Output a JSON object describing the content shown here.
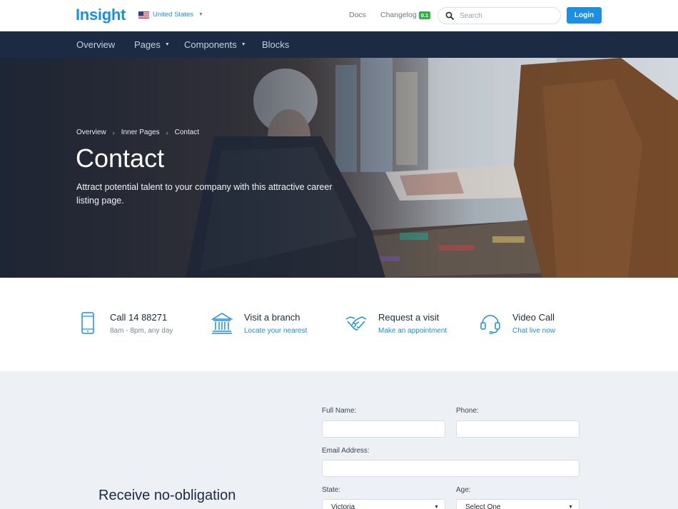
{
  "header": {
    "logo": "Insight",
    "locale": "United States",
    "links": {
      "docs": "Docs",
      "changelog": "Changelog",
      "changelog_badge": "0.1"
    },
    "search_placeholder": "Search",
    "login": "Login"
  },
  "nav": {
    "items": [
      {
        "label": "Overview"
      },
      {
        "label": "Pages"
      },
      {
        "label": "Components"
      },
      {
        "label": "Blocks"
      }
    ]
  },
  "hero": {
    "breadcrumb": [
      "Overview",
      "Inner Pages",
      "Contact"
    ],
    "title": "Contact",
    "subtitle": "Attract potential talent to your company with this attractive career listing page."
  },
  "contact_options": [
    {
      "icon": "phone-icon",
      "title": "Call 14 88271",
      "subtitle": "8am - 8pm, any day"
    },
    {
      "icon": "bank-icon",
      "title": "Visit a branch",
      "subtitle": "Locate your nearest"
    },
    {
      "icon": "handshake-icon",
      "title": "Request a visit",
      "subtitle": "Make an appointment"
    },
    {
      "icon": "headset-icon",
      "title": "Video Call",
      "subtitle": "Chat live now"
    }
  ],
  "form": {
    "heading": "Receive no-obligation",
    "labels": {
      "full_name": "Full Name:",
      "phone": "Phone:",
      "email": "Email Address:",
      "state": "State:",
      "age": "Age:"
    },
    "state_value": "Victoria",
    "age_value": "Select One"
  },
  "colors": {
    "accent": "#1a8fe3",
    "nav_bg": "#1d2a44",
    "badge": "#2fb344",
    "form_bg": "#edf0f4"
  }
}
